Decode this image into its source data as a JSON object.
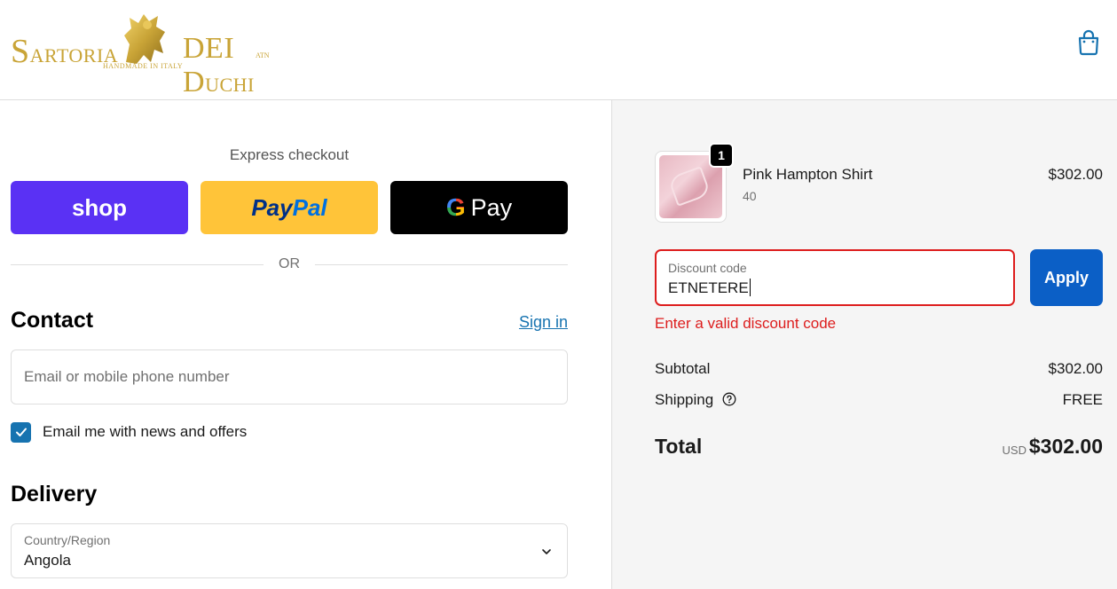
{
  "header": {
    "logo": {
      "word1_cap": "S",
      "word1_rest": "ARTORIA",
      "word2_cap": "DEI D",
      "word2_rest": "UCHI",
      "tagline": "HANDMADE IN ITALY",
      "suffix": "ATN"
    },
    "icons": {
      "cart": "shopping-bag-icon"
    },
    "colors": {
      "logo_gold": "#c9a437",
      "cart_blue": "#1773b0"
    }
  },
  "express": {
    "title": "Express checkout",
    "shop_label": "shop",
    "paypal_label_1": "Pay",
    "paypal_label_2": "Pal",
    "gpay_g": "G",
    "gpay_label": "Pay",
    "or_label": "OR"
  },
  "contact": {
    "heading": "Contact",
    "signin_link": "Sign in",
    "email_placeholder": "Email or mobile phone number",
    "newsletter_checked": true,
    "newsletter_label": "Email me with news and offers"
  },
  "delivery": {
    "heading": "Delivery",
    "country_label": "Country/Region",
    "country_value": "Angola"
  },
  "summary": {
    "product": {
      "name": "Pink Hampton Shirt",
      "variant": "40",
      "price": "$302.00",
      "quantity": "1"
    },
    "discount": {
      "label": "Discount code",
      "value": "ETNETERE",
      "apply_label": "Apply",
      "error": "Enter a valid discount code"
    },
    "subtotal_label": "Subtotal",
    "subtotal_value": "$302.00",
    "shipping_label": "Shipping",
    "shipping_value": "FREE",
    "total_label": "Total",
    "currency": "USD",
    "total_value": "$302.00"
  },
  "colors": {
    "shop_purple": "#5a31f4",
    "paypal_yellow": "#ffc439",
    "gpay_black": "#000000",
    "link_blue": "#1773b0",
    "apply_blue": "#0b5fc6",
    "error_red": "#dd1d1d"
  }
}
